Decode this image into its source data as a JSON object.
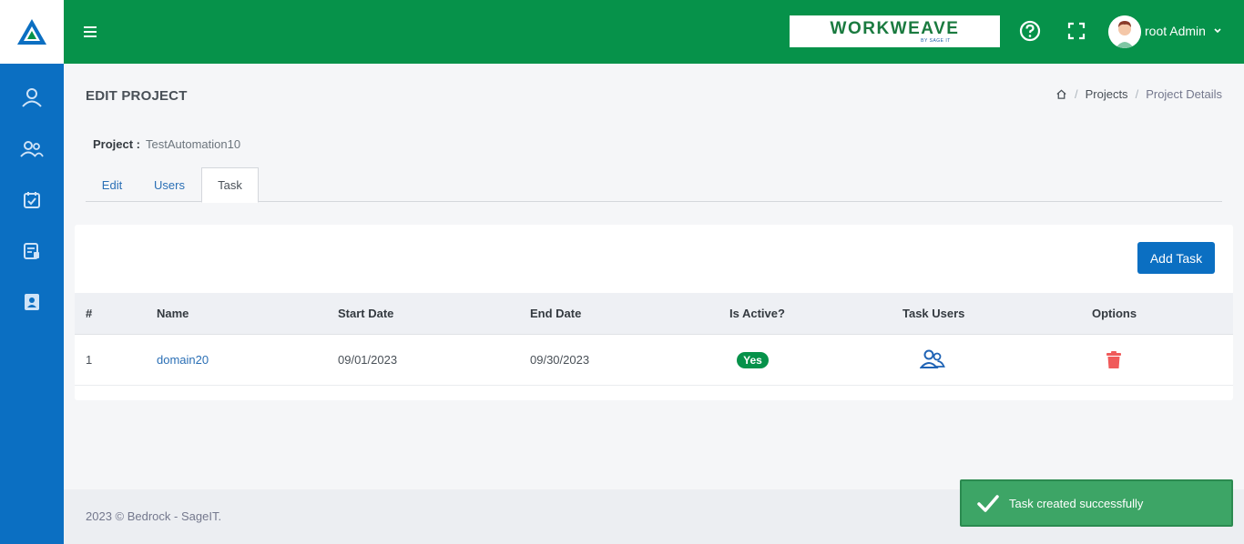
{
  "brand": {
    "name": "WORKWEAVE",
    "sub": "BY SAGE IT"
  },
  "colors": {
    "sidebar": "#0b6fc2",
    "topbar": "#06924a",
    "accent": "#0b6fc2",
    "success": "#3da566",
    "danger": "#f05a5a"
  },
  "sidebar": {
    "items": [
      {
        "icon": "user-icon"
      },
      {
        "icon": "users-icon"
      },
      {
        "icon": "calendar-check-icon"
      },
      {
        "icon": "report-icon"
      },
      {
        "icon": "contact-card-icon"
      }
    ]
  },
  "header": {
    "user_name": "root Admin"
  },
  "page": {
    "title": "EDIT PROJECT",
    "breadcrumb": [
      "Projects",
      "Project Details"
    ],
    "project_label": "Project :",
    "project_value": "TestAutomation10"
  },
  "tabs": [
    {
      "label": "Edit",
      "active": false
    },
    {
      "label": "Users",
      "active": false
    },
    {
      "label": "Task",
      "active": true
    }
  ],
  "task_table": {
    "add_button": "Add Task",
    "columns": [
      "#",
      "Name",
      "Start Date",
      "End Date",
      "Is Active?",
      "Task Users",
      "Options"
    ],
    "rows": [
      {
        "index": "1",
        "name": "domain20",
        "start_date": "09/01/2023",
        "end_date": "09/30/2023",
        "is_active": "Yes"
      }
    ]
  },
  "footer": {
    "text": "2023 © Bedrock - SageIT."
  },
  "toast": {
    "message": "Task created successfully"
  }
}
